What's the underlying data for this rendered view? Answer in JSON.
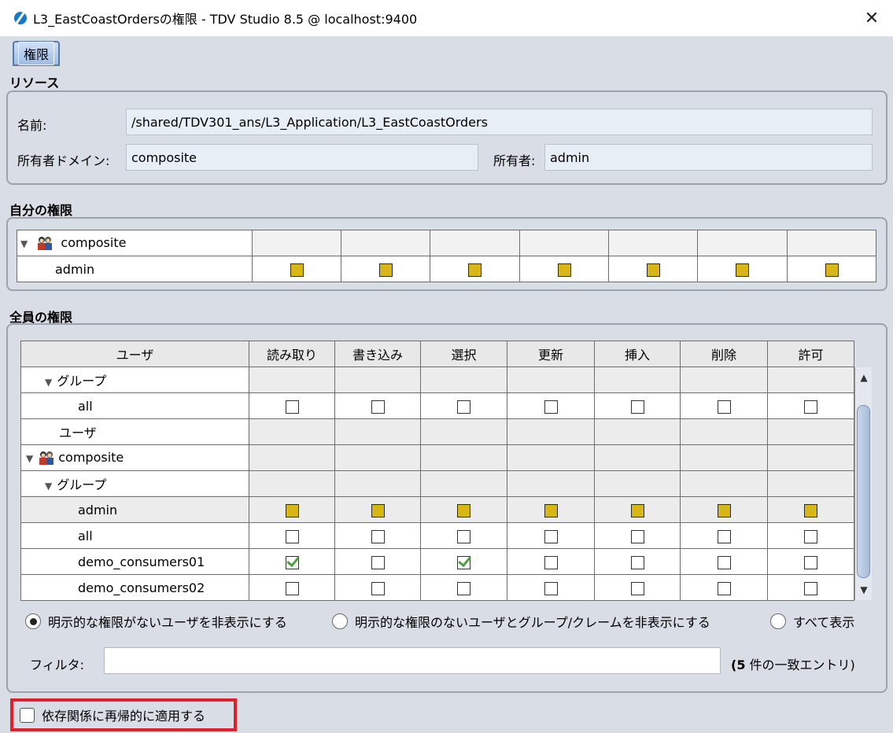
{
  "window": {
    "title": "L3_EastCoastOrdersの権限 - TDV Studio 8.5 @ localhost:9400"
  },
  "tab": {
    "label": "権限"
  },
  "resource": {
    "section_title": "リソース",
    "name_label": "名前:",
    "name_value": "/shared/TDV301_ans/L3_Application/L3_EastCoastOrders",
    "domain_label": "所有者ドメイン:",
    "domain_value": "composite",
    "owner_label": "所有者:",
    "owner_value": "admin"
  },
  "my_perms": {
    "section_title": "自分の権限",
    "rows": [
      {
        "label": "composite",
        "type": "group"
      },
      {
        "label": "admin",
        "type": "user",
        "states": [
          "gold",
          "gold",
          "gold",
          "gold",
          "gold",
          "gold",
          "gold"
        ]
      }
    ]
  },
  "all_perms": {
    "section_title": "全員の権限",
    "headers": [
      "ユーザ",
      "読み取り",
      "書き込み",
      "選択",
      "更新",
      "挿入",
      "削除",
      "許可"
    ],
    "rows": [
      {
        "label": "グループ",
        "indent": 1,
        "tri": true
      },
      {
        "label": "all",
        "indent": 2,
        "states": [
          "empty",
          "empty",
          "empty",
          "empty",
          "empty",
          "empty",
          "empty"
        ]
      },
      {
        "label": "ユーザ",
        "indent": 1,
        "tri": false
      },
      {
        "label": "composite",
        "indent": 0,
        "tri": true,
        "icon": true
      },
      {
        "label": "グループ",
        "indent": 1,
        "tri": true
      },
      {
        "label": "admin",
        "indent": 2,
        "states": [
          "gold",
          "gold",
          "gold",
          "gold",
          "gold",
          "gold",
          "gold"
        ],
        "highlight": true
      },
      {
        "label": "all",
        "indent": 2,
        "states": [
          "empty",
          "empty",
          "empty",
          "empty",
          "empty",
          "empty",
          "empty"
        ]
      },
      {
        "label": "demo_consumers01",
        "indent": 2,
        "states": [
          "checked",
          "empty",
          "checked",
          "empty",
          "empty",
          "empty",
          "empty"
        ]
      },
      {
        "label": "demo_consumers02",
        "indent": 2,
        "states": [
          "empty",
          "empty",
          "empty",
          "empty",
          "empty",
          "empty",
          "empty"
        ]
      }
    ]
  },
  "filter_options": {
    "opt1": "明示的な権限がないユーザを非表示にする",
    "opt2": "明示的な権限のないユーザとグループ/クレームを非表示にする",
    "opt3": "すべて表示"
  },
  "filter": {
    "label": "フィルタ:",
    "value": "",
    "count_bold": "(5",
    "count_rest": " 件の一致エントリ)"
  },
  "recursive": {
    "label": "依存関係に再帰的に適用する"
  }
}
